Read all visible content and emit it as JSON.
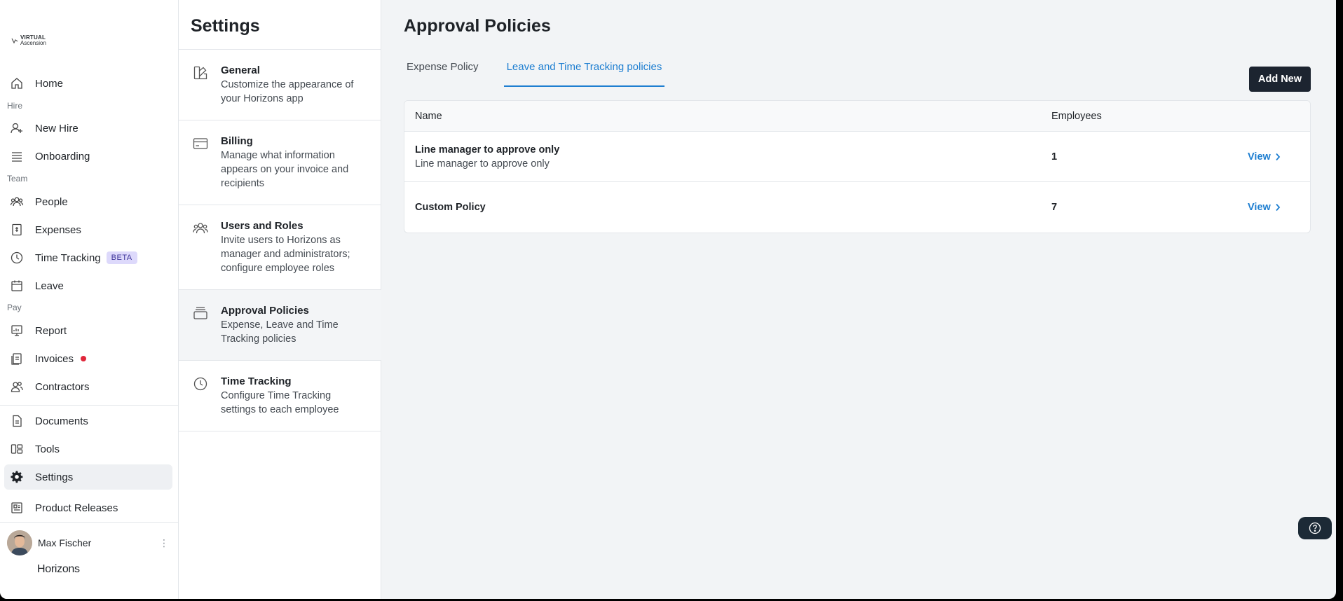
{
  "brand": {
    "line1": "VIRTUAL",
    "line2": "Ascension"
  },
  "nav": {
    "sections": {
      "hire": "Hire",
      "team": "Team",
      "pay": "Pay"
    },
    "items": {
      "home": "Home",
      "new_hire": "New Hire",
      "onboarding": "Onboarding",
      "people": "People",
      "expenses": "Expenses",
      "time_tracking": "Time Tracking",
      "time_tracking_badge": "BETA",
      "leave": "Leave",
      "report": "Report",
      "invoices": "Invoices",
      "contractors": "Contractors",
      "documents": "Documents",
      "tools": "Tools",
      "settings": "Settings",
      "product_releases": "Product Releases"
    },
    "user": {
      "name": "Max Fischer",
      "menu": "⋮"
    },
    "footer_logo": "Horizons"
  },
  "settings": {
    "title": "Settings",
    "items": [
      {
        "title": "General",
        "desc": "Customize the appearance of your Horizons app"
      },
      {
        "title": "Billing",
        "desc": "Manage what information appears on your invoice and recipients"
      },
      {
        "title": "Users and Roles",
        "desc": "Invite users to Horizons as manager and administrators; configure employee roles"
      },
      {
        "title": "Approval Policies",
        "desc": "Expense, Leave and Time Tracking policies"
      },
      {
        "title": "Time Tracking",
        "desc": "Configure Time Tracking settings to each employee"
      }
    ]
  },
  "main": {
    "title": "Approval Policies",
    "tabs": [
      {
        "label": "Expense Policy",
        "active": false
      },
      {
        "label": "Leave and Time Tracking policies",
        "active": true
      }
    ],
    "add_button": "Add New",
    "table": {
      "headers": {
        "name": "Name",
        "employees": "Employees"
      },
      "rows": [
        {
          "title": "Line manager to approve only",
          "subtitle": "Line manager to approve only",
          "employees": "1",
          "action": "View"
        },
        {
          "title": "Custom Policy",
          "subtitle": "",
          "employees": "7",
          "action": "View"
        }
      ]
    }
  },
  "colors": {
    "accent": "#1f7fd1",
    "dark_button": "#1c2430",
    "beta_bg": "#ddd9fb",
    "notification": "#e0263a"
  }
}
